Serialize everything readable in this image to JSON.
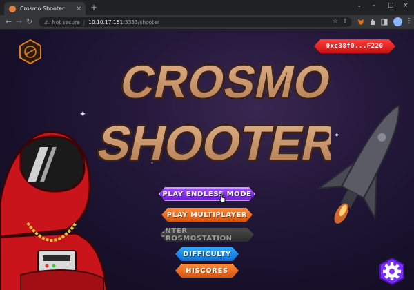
{
  "browser": {
    "tab_title": "Crosmo Shooter",
    "tab_close": "×",
    "new_tab": "+",
    "security_label": "Not secure",
    "url_host": "10.10.17.151",
    "url_rest": ":3333/shooter",
    "window_controls": [
      "⌄",
      "–",
      "□",
      "×"
    ]
  },
  "game": {
    "wallet_address": "0xc38f0...F220",
    "title_line1": "CROSMO",
    "title_line2": "SHOOTER",
    "menu": {
      "endless": "PLAY ENDLESS MODE",
      "multiplayer": "PLAY MULTIPLAYER",
      "crosmostation": "ENTER CROSMOSTATION",
      "difficulty": "DIFFICULTY",
      "hiscores": "HISCORES"
    },
    "colors": {
      "endless": "#8a2be2",
      "multiplayer": "#f06a1f",
      "crosmostation": "#3a3a3a",
      "difficulty": "#1e90ff",
      "hiscores": "#f06a1f",
      "wallet": "#e61e1e",
      "settings": "#7b2cff"
    },
    "icons": [
      "crosmo-logo-icon",
      "gear-icon",
      "cursor-icon"
    ]
  }
}
